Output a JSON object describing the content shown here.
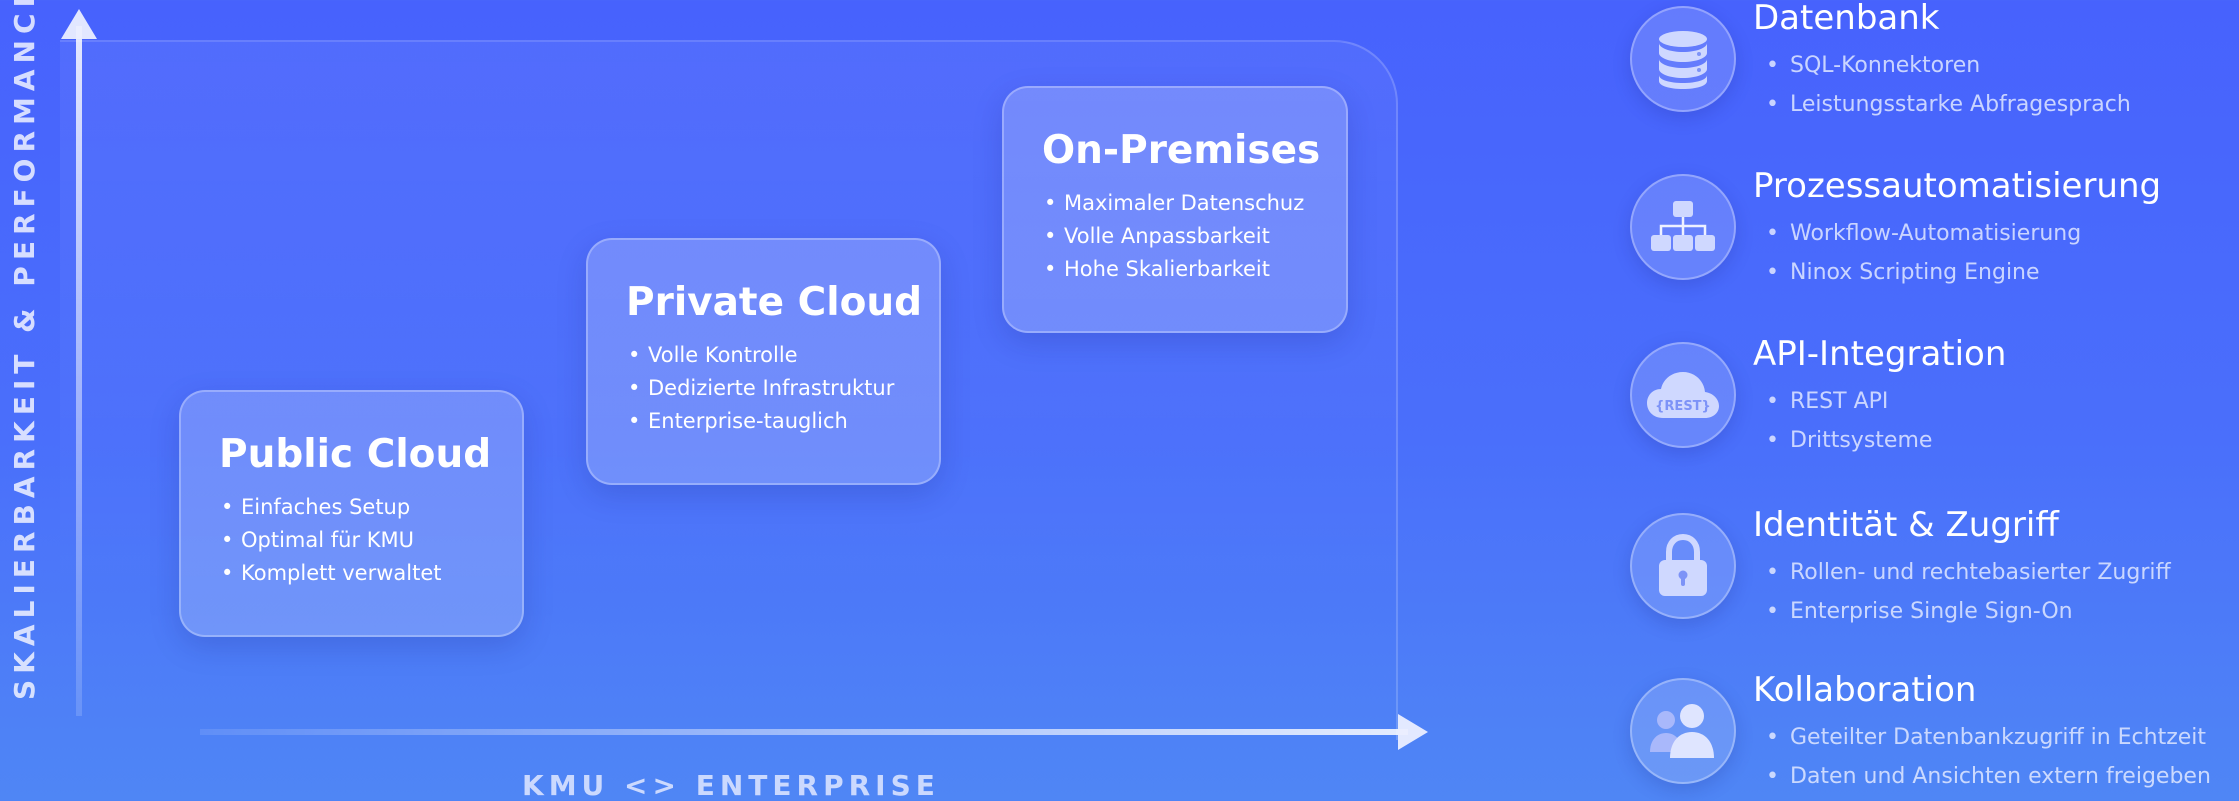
{
  "axes": {
    "y_label": "SKALIERBARKEIT & PERFORMANCE",
    "x_label": "KMU <> ENTERPRISE"
  },
  "tiers": [
    {
      "title": "Public Cloud",
      "points": [
        "Einfaches Setup",
        "Optimal für KMU",
        "Komplett verwaltet"
      ]
    },
    {
      "title": "Private Cloud",
      "points": [
        "Volle Kontrolle",
        "Dedizierte Infrastruktur",
        "Enterprise-tauglich"
      ]
    },
    {
      "title": "On-Premises",
      "points": [
        "Maximaler Datenschuz",
        "Volle Anpassbarkeit",
        "Hohe Skalierbarkeit"
      ]
    }
  ],
  "features": [
    {
      "icon": "database-icon",
      "title": "Datenbank",
      "points": [
        "SQL-Konnektoren",
        "Leistungsstarke Abfragesprach"
      ]
    },
    {
      "icon": "workflow-icon",
      "title": "Prozessautomatisierung",
      "points": [
        "Workflow-Automatisierung",
        "Ninox Scripting Engine"
      ]
    },
    {
      "icon": "rest-cloud-icon",
      "icon_text": "{REST}",
      "title": "API-Integration",
      "points": [
        "REST API",
        "Drittsysteme"
      ]
    },
    {
      "icon": "lock-icon",
      "title": "Identität & Zugriff",
      "points": [
        "Rollen- und rechtebasierter Zugriff",
        "Enterprise Single Sign-On"
      ]
    },
    {
      "icon": "users-icon",
      "title": "Kollaboration",
      "points": [
        "Geteilter Datenbankzugriff in Echtzeit",
        "Daten und Ansichten extern freigeben"
      ]
    }
  ],
  "colors": {
    "background_top": "#4762fd",
    "background_bottom": "#4f86f5",
    "icon_fill": "#cfd8ff"
  }
}
